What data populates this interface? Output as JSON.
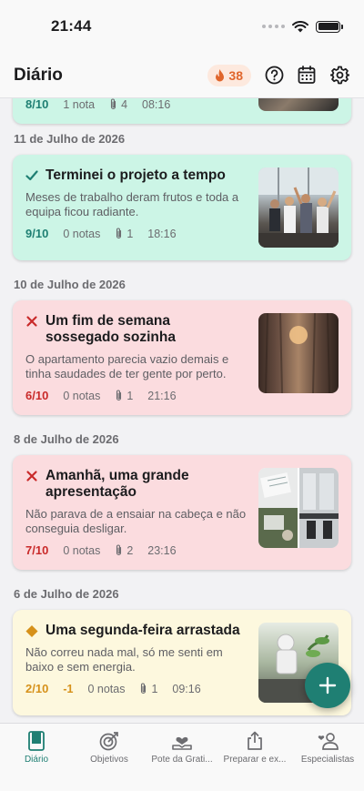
{
  "status": {
    "time": "21:44"
  },
  "header": {
    "title": "Diário",
    "streak": "38"
  },
  "top_card": {
    "score": "8/10",
    "notes": "1 nota",
    "attachments": "4",
    "time": "08:16"
  },
  "entries": [
    {
      "date": "11 de Julho de 2026",
      "title": "Terminei o projeto a tempo",
      "text": "Meses de trabalho deram frutos e toda a equipa ficou radiante.",
      "score": "9/10",
      "notes": "0 notas",
      "attachments": "1",
      "time": "18:16",
      "mood": "good"
    },
    {
      "date": "10 de Julho de 2026",
      "title": "Um fim de semana sossegado sozinha",
      "text": "O apartamento parecia vazio demais e tinha saudades de ter gente por perto.",
      "score": "6/10",
      "notes": "0 notas",
      "attachments": "1",
      "time": "21:16",
      "mood": "bad"
    },
    {
      "date": "8 de Julho de 2026",
      "title": "Amanhã, uma grande apresentação",
      "text": "Não parava de a ensaiar na cabeça e não conseguia desligar.",
      "score": "7/10",
      "notes": "0 notas",
      "attachments": "2",
      "time": "23:16",
      "mood": "bad"
    },
    {
      "date": "6 de Julho de 2026",
      "title": "Uma segunda-feira arrastada",
      "text": "Não correu nada mal, só me senti em baixo e sem energia.",
      "score": "2/10",
      "delta": "-1",
      "notes": "0 notas",
      "attachments": "1",
      "time": "09:16",
      "mood": "meh"
    }
  ],
  "tabs": [
    {
      "label": "Diário",
      "icon": "journal-icon",
      "active": true
    },
    {
      "label": "Objetivos",
      "icon": "target-icon"
    },
    {
      "label": "Pote da Grati...",
      "icon": "gratitude-jar-icon"
    },
    {
      "label": "Preparar e ex...",
      "icon": "share-export-icon"
    },
    {
      "label": "Especialistas",
      "icon": "specialists-icon"
    }
  ],
  "colors": {
    "accent": "#1f7f73",
    "good_card": "#ccf5e6",
    "bad_card": "#fbdcdf",
    "meh_card": "#fdf8de",
    "streak": "#e0662c"
  },
  "icons": {
    "good": "checkmark-icon",
    "bad": "cross-icon",
    "meh": "diamond-icon",
    "attachment": "paperclip-icon"
  }
}
